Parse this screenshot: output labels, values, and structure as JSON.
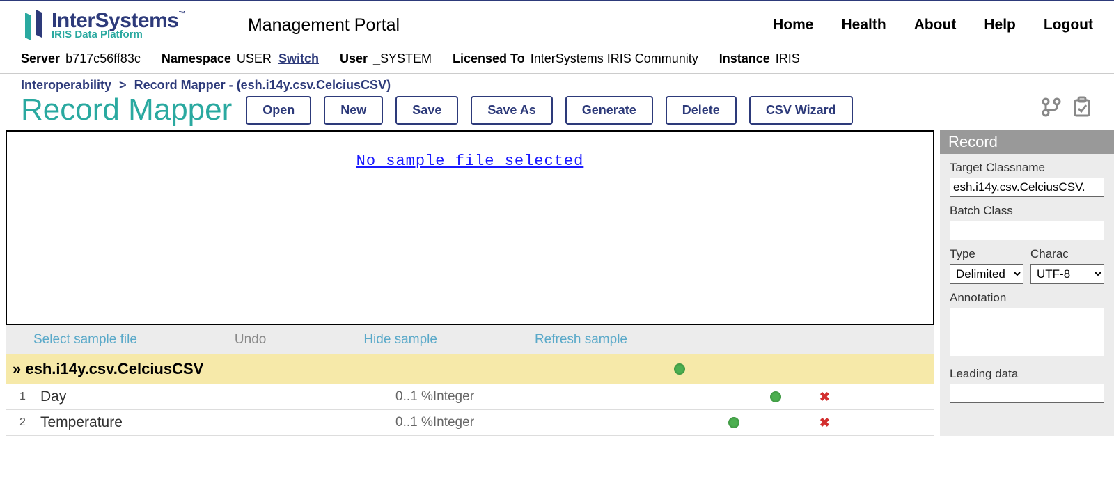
{
  "logo": {
    "main": "InterSystems",
    "tm": "™",
    "sub": "IRIS Data Platform"
  },
  "portalTitle": "Management Portal",
  "nav": {
    "home": "Home",
    "health": "Health",
    "about": "About",
    "help": "Help",
    "logout": "Logout"
  },
  "info": {
    "serverLbl": "Server",
    "serverVal": "b717c56ff83c",
    "nsLbl": "Namespace",
    "nsVal": "USER",
    "switch": "Switch",
    "userLbl": "User",
    "userVal": "_SYSTEM",
    "licLbl": "Licensed To",
    "licVal": "InterSystems IRIS Community",
    "instLbl": "Instance",
    "instVal": "IRIS"
  },
  "breadcrumb": {
    "a": "Interoperability",
    "sep": ">",
    "b": "Record Mapper",
    "suffix": " - (esh.i14y.csv.CelciusCSV)"
  },
  "pageTitle": "Record Mapper",
  "buttons": {
    "open": "Open",
    "new": "New",
    "save": "Save",
    "saveAs": "Save As",
    "generate": "Generate",
    "delete": "Delete",
    "csvWizard": "CSV Wizard"
  },
  "sampleLink": "No sample file selected",
  "toolbar2": {
    "select": "Select sample file",
    "undo": "Undo",
    "hide": "Hide sample",
    "refresh": "Refresh sample"
  },
  "recordName": "» esh.i14y.csv.CelciusCSV",
  "fields": [
    {
      "idx": "1",
      "name": "Day",
      "type": "0..1 %Integer"
    },
    {
      "idx": "2",
      "name": "Temperature",
      "type": "0..1 %Integer"
    }
  ],
  "panel": {
    "header": "Record",
    "targetLbl": "Target Classname",
    "targetVal": "esh.i14y.csv.CelciusCSV.",
    "batchLbl": "Batch Class",
    "batchVal": "",
    "typeLbl": "Type",
    "typeVal": "Delimited",
    "charLbl": "Charac",
    "charVal": "UTF-8",
    "annoLbl": "Annotation",
    "annoVal": "",
    "leadingLbl": "Leading data",
    "leadingVal": ""
  }
}
